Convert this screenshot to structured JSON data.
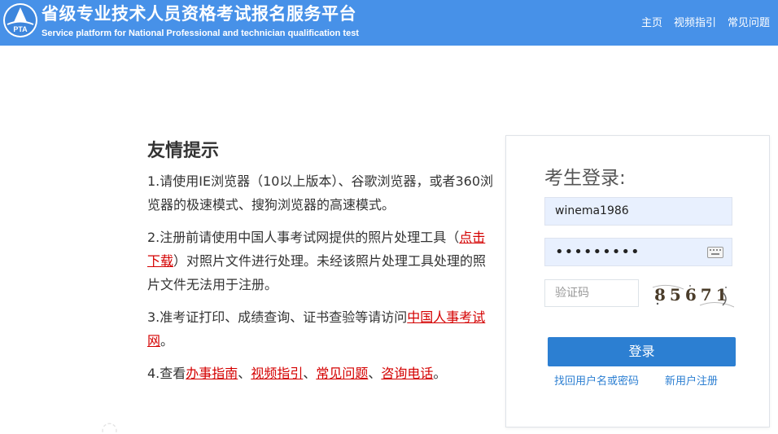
{
  "header": {
    "title": "省级专业技术人员资格考试报名服务平台",
    "subtitle": "Service platform for National Professional and technician qualification test",
    "logo_text": "PTA",
    "nav": [
      "主页",
      "视频指引",
      "常见问题"
    ]
  },
  "tips": {
    "title": "友情提示",
    "items": [
      {
        "text": "1.请使用IE浏览器（10以上版本）、谷歌浏览器，或者360浏览器的极速模式、搜狗浏览器的高速模式。"
      },
      {
        "pre": "2.注册前请使用中国人事考试网提供的照片处理工具（",
        "link": "点击下载",
        "post": "）对照片文件进行处理。未经该照片处理工具处理的照片文件无法用于注册。"
      },
      {
        "pre": "3.准考证打印、成绩查询、证书查验等请访问",
        "link": "中国人事考试网",
        "post": "。"
      },
      {
        "pre": "4.查看",
        "links": [
          "办事指南",
          "视频指引",
          "常见问题",
          "咨询电话"
        ],
        "sep": "、",
        "post": "。"
      }
    ]
  },
  "login": {
    "title": "考生登录:",
    "username": "winema1986",
    "password": "•••••••••",
    "captcha_placeholder": "验证码",
    "captcha_code": "85671",
    "submit": "登录",
    "recover": "找回用户名或密码",
    "register": "新用户注册"
  },
  "colors": {
    "header_bg": "#4791e8",
    "link_red": "#d40000",
    "button_blue": "#2c7fd2",
    "input_fill": "#e8f0fe"
  }
}
